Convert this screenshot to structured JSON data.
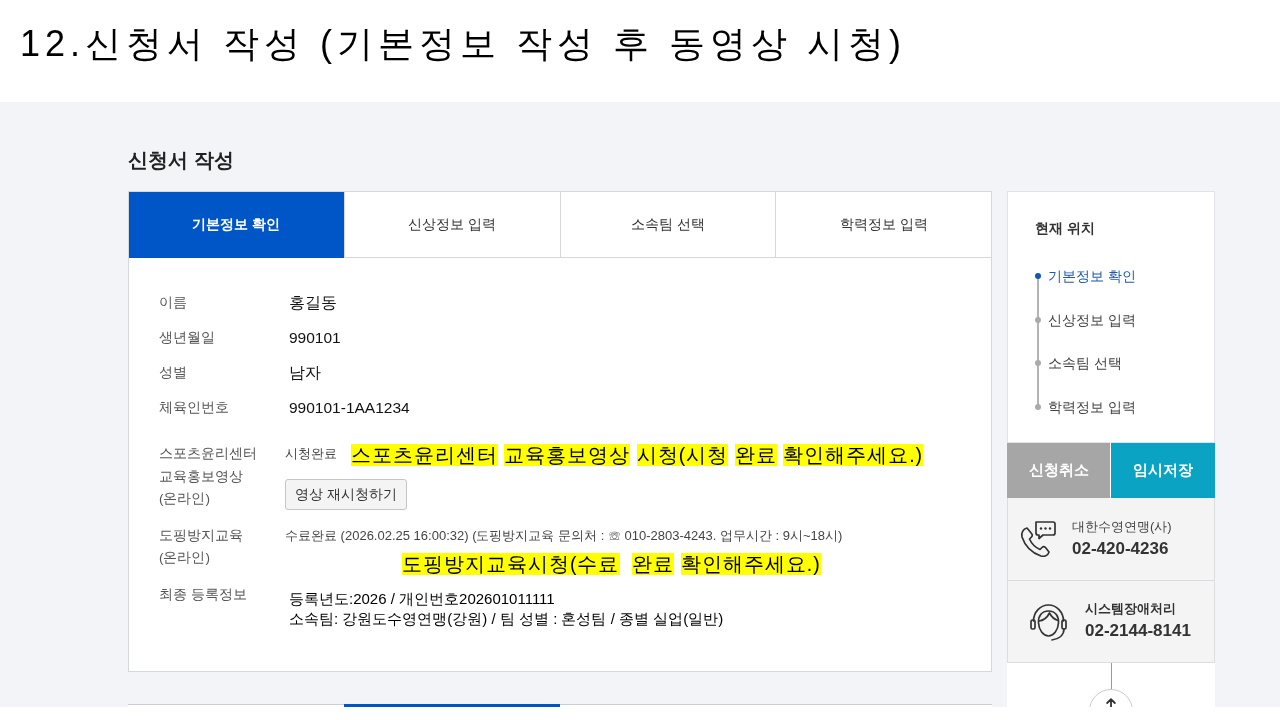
{
  "slide_title": "12.신청서 작성 (기본정보 작성 후 동영상 시청)",
  "page_heading": "신청서 작성",
  "tabs": [
    {
      "label": "기본정보 확인",
      "selected": true
    },
    {
      "label": "신상정보 입력",
      "selected": false
    },
    {
      "label": "소속팀 선택",
      "selected": false
    },
    {
      "label": "학력정보 입력",
      "selected": false
    }
  ],
  "fields": [
    {
      "kind": "text",
      "label": "이름",
      "value": "홍길동"
    },
    {
      "kind": "text",
      "label": "생년월일",
      "value": "990101"
    },
    {
      "kind": "text",
      "label": "성별",
      "value": "남자"
    },
    {
      "kind": "text",
      "label": "체육인번호",
      "value": "990101-1AA1234"
    },
    {
      "kind": "video",
      "label": "스포츠윤리센터 교육홍보영상 (온라인)",
      "status": "시청완료",
      "note": "스포츠윤리센터 교육홍보영상 시청(시청 완료 확인해주세요.)",
      "button": "영상 재시청하기"
    },
    {
      "kind": "course",
      "label": "도핑방지교육 (온라인)",
      "status": "수료완료 (2026.02.25 16:00:32) (도핑방지교육 문의처 : ☏ 010-2803-4243. 업무시간 : 9시~18시)",
      "note": "도핑방지교육시청(수료  완료 확인해주세요.)"
    },
    {
      "kind": "lines",
      "label": "최종 등록정보",
      "lines": [
        "등록년도:2026 / 개인번호202601011111",
        "소속팀: 강원도수영연맹(강원) / 팀 성별 : 혼성팀 / 종별 실업(일반)"
      ]
    }
  ],
  "next_tabs": [
    {
      "selected": false
    },
    {
      "selected": true
    },
    {
      "selected": false
    },
    {
      "selected": false
    }
  ],
  "sidebar": {
    "title": "현재 위치",
    "steps": [
      {
        "label": "기본정보 확인",
        "selected": true
      },
      {
        "label": "신상정보 입력",
        "selected": false
      },
      {
        "label": "소속팀 선택",
        "selected": false
      },
      {
        "label": "학력정보 입력",
        "selected": false
      }
    ],
    "buttons": [
      {
        "kind": "cancel",
        "label": "신청취소"
      },
      {
        "kind": "save",
        "label": "임시저장"
      }
    ],
    "contacts": [
      {
        "kind": "phone",
        "name": "대한수영연맹(사)",
        "phone": "02-420-4236"
      },
      {
        "kind": "support",
        "name": "시스템장애처리",
        "phone": "02-2144-8141"
      }
    ]
  }
}
